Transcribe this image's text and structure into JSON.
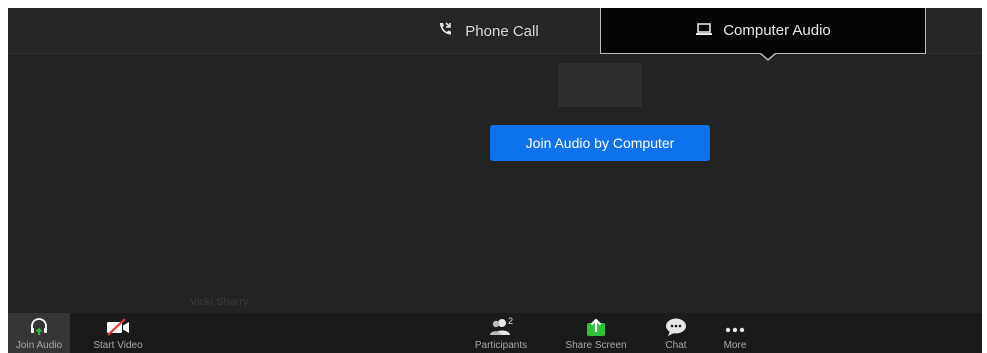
{
  "audio_tabs": {
    "phone_call": "Phone Call",
    "computer_audio": "Computer Audio",
    "selected": "computer_audio"
  },
  "main": {
    "join_button_label": "Join Audio by Computer",
    "participant_name": "Vicki Sharry"
  },
  "toolbar": {
    "join_audio": "Join Audio",
    "start_video": "Start Video",
    "participants": "Participants",
    "participants_count": "2",
    "share_screen": "Share Screen",
    "chat": "Chat",
    "more": "More"
  },
  "colors": {
    "join_button": "#0e72ed",
    "share_icon": "#2ec23a",
    "join_audio_icon_arrow": "#2ec23a",
    "video_slash": "#e0393e"
  }
}
